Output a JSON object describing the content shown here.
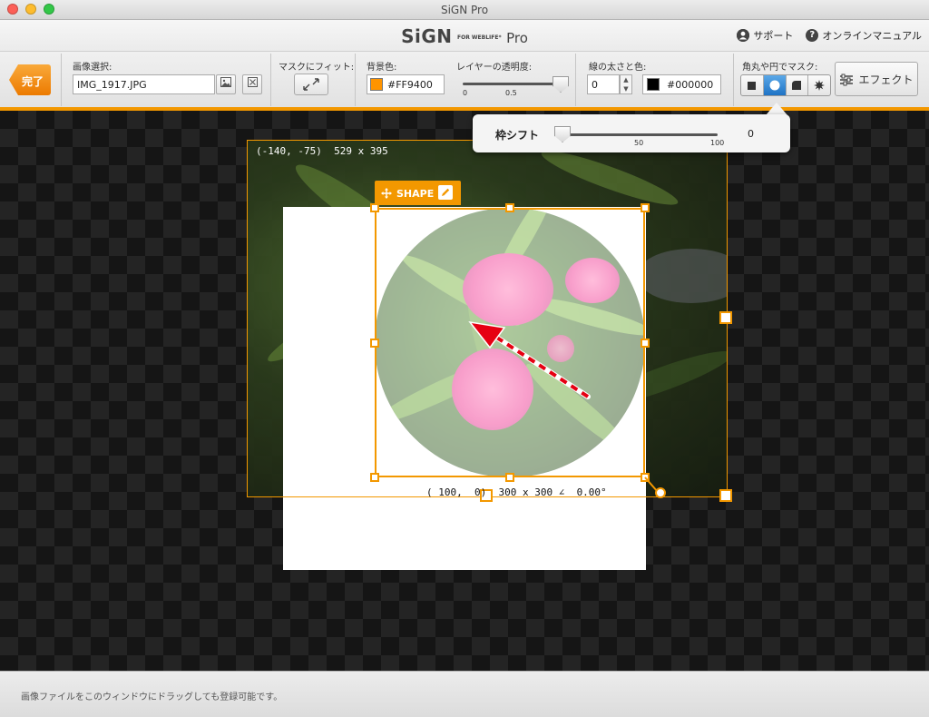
{
  "window": {
    "title": "SiGN Pro",
    "traffic_colors": [
      "#fc5f57",
      "#fdbc2e",
      "#33c748"
    ]
  },
  "header": {
    "logo_main": "SiGN",
    "logo_small": "FOR WEBLIFE*",
    "logo_pro": "Pro",
    "support": "サポート",
    "manual": "オンラインマニュアル"
  },
  "toolbar": {
    "done": "完了",
    "image_select_label": "画像選択:",
    "image_file": "IMG_1917.JPG",
    "fit_label": "マスクにフィット:",
    "bg_color_label": "背景色:",
    "bg_color_value": "#FF9400",
    "bg_color_swatch": "#FF9400",
    "opacity_label": "レイヤーの透明度:",
    "opacity_min": "0",
    "opacity_mid": "0.5",
    "opacity_value": 1.0,
    "line_label": "線の太さと色:",
    "line_width": "0",
    "line_color_value": "#000000",
    "line_color_swatch": "#000000",
    "mask_label": "角丸や円でマスク:",
    "mask_options": [
      "square-mask",
      "circle-mask",
      "corner-mask",
      "burst-mask"
    ],
    "mask_selected": "circle-mask",
    "effect": "エフェクト"
  },
  "popover": {
    "label": "枠シフト",
    "tick_50": "50",
    "tick_100": "100",
    "value": "0",
    "value_fraction": 0.0
  },
  "canvas": {
    "outer_coord": "(-140, -75)  529 x 395",
    "inner_coord": "( 100,  0)  300 x 300 ∠  0.00°",
    "shape_tag": "SHAPE",
    "accent": "#f39800"
  },
  "status": {
    "message": "画像ファイルをこのウィンドウにドラッグしても登録可能です。"
  }
}
